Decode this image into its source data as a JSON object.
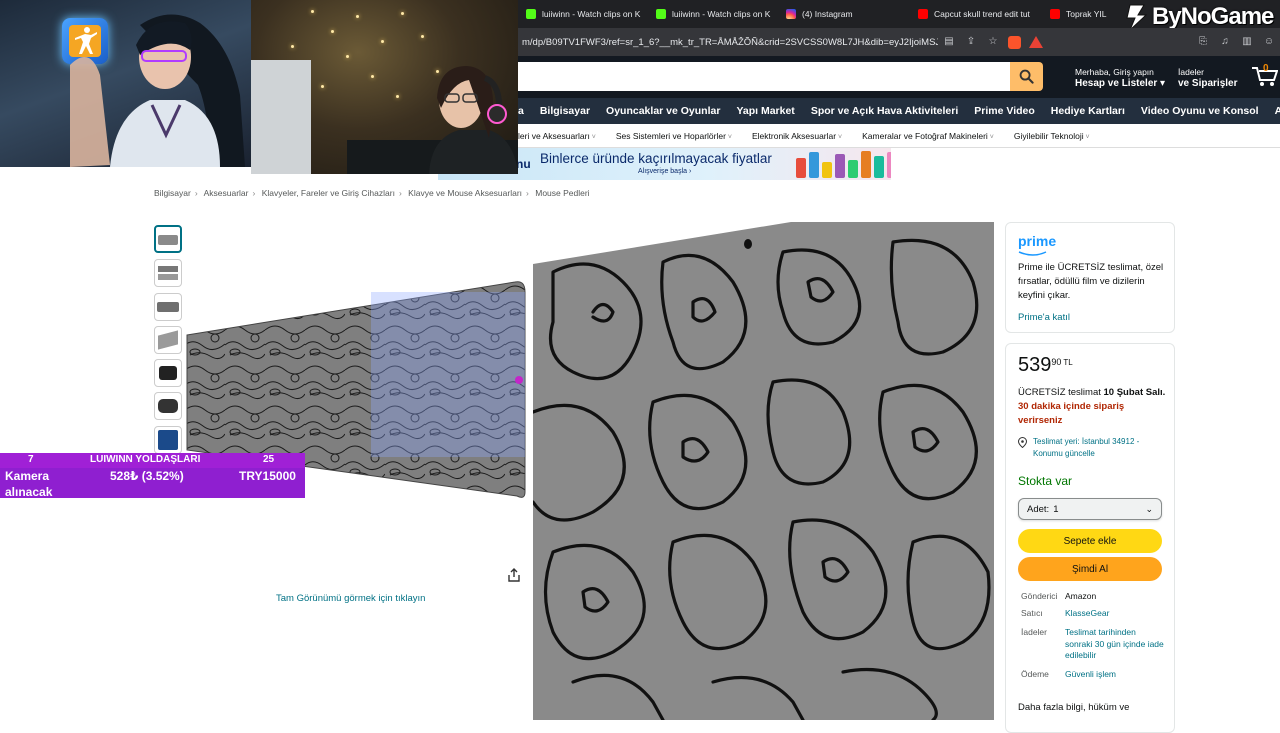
{
  "browser": {
    "tabs": [
      {
        "label": "luiiwinn - Watch clips on K",
        "icon": "kick"
      },
      {
        "label": "luiiwinn - Watch clips on K",
        "icon": "kick"
      },
      {
        "label": "(4) Instagram",
        "icon": "instagram"
      },
      {
        "label": "Capcut skull trend edit tut",
        "icon": "youtube"
      },
      {
        "label": "Toprak YIL",
        "icon": "youtube"
      }
    ],
    "url": "m/dp/B09TV1FWF3/ref=sr_1_6?__mk_tr_TR=ÅMÅŽÕÑ&crid=2SVCSS0W8L7JH&dib=eyJ2IjoiMSJ9..."
  },
  "watermark": "ByNoGame",
  "header": {
    "greeting": "Merhaba, Giriş yapın",
    "account_lists": "Hesap ve Listeler",
    "returns_line1": "İadeler",
    "returns_line2": "ve Siparişler",
    "cart_count": "0",
    "search_placeholder": ""
  },
  "nav": {
    "items": [
      "a",
      "Bilgisayar",
      "Oyuncaklar ve Oyunlar",
      "Yapı Market",
      "Spor ve Açık Hava Aktiviteleri",
      "Prime Video",
      "Hediye Kartları",
      "Video Oyunu ve Konsol",
      "Amazon Ayrıcalıkları"
    ]
  },
  "subnav": {
    "items": [
      "leri ve Aksesuarları",
      "Ses Sistemleri ve Hoparlörler",
      "Elektronik Aksesuarlar",
      "Kameralar ve Fotoğraf Makineleri",
      "Giyilebilir Teknoloji"
    ]
  },
  "banner": {
    "prefix": "nu",
    "title": "Binlerce üründe kaçırılmayacak fiyatlar",
    "subtitle": "Alışverişe başla ›"
  },
  "breadcrumb": [
    "Bilgisayar",
    "Aksesuarlar",
    "Klavyeler, Fareler ve Giriş Cihazları",
    "Klavye ve Mouse Aksesuarları",
    "Mouse Pedleri"
  ],
  "product": {
    "full_view_link": "Tam Görünümü görmek için tıklayın"
  },
  "goal": {
    "left_count": "7",
    "title": "LUIWINN YOLDAŞLARI",
    "right_count": "25",
    "label_line1": "Kamera",
    "label_line2": "alınacak",
    "amount": "528₺ (3.52%)",
    "target": "TRY15000"
  },
  "prime_box": {
    "logo": "prime",
    "text": "Prime ile ÜCRETSİZ teslimat, özel fırsatlar, ödüllü film ve dizilerin keyfini çıkar.",
    "link": "Prime'a katıl"
  },
  "buybox": {
    "price_whole": "539",
    "price_fraction": "90",
    "currency": "TL",
    "delivery_free": "ÜCRETSİZ teslimat",
    "delivery_date": "10 Şubat Salı.",
    "delivery_deadline": "30 dakika içinde sipariş verirseniz",
    "location_line1": "Teslimat yeri: İstanbul 34912 -",
    "location_line2": "Konumu güncelle",
    "stock": "Stokta var",
    "quantity_label": "Adet:",
    "quantity_value": "1",
    "add_to_cart": "Sepete ekle",
    "buy_now": "Şimdi Al",
    "details": [
      {
        "key": "Gönderici",
        "value": "Amazon"
      },
      {
        "key": "Satıcı",
        "value": "KlasseGear"
      },
      {
        "key": "İadeler",
        "value": "Teslimat tarihinden sonraki 30 gün içinde iade edilebilir"
      },
      {
        "key": "Ödeme",
        "value": "Güvenli işlem"
      }
    ],
    "more_info": "Daha fazla bilgi, hüküm ve"
  },
  "colors": {
    "amazon_dark": "#131921",
    "amazon_nav": "#232f3e",
    "search_orange": "#febd69",
    "add_to_cart": "#ffd814",
    "buy_now": "#ffa41c",
    "goal_purple": "#a020d6",
    "in_stock": "#007600",
    "link": "#007185"
  }
}
